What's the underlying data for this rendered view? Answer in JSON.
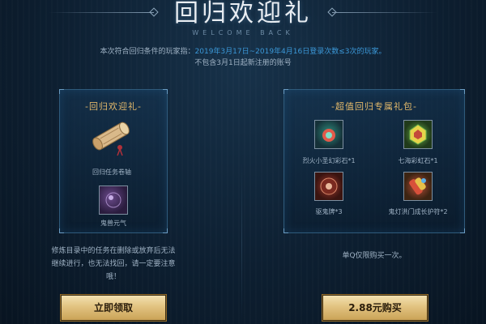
{
  "header": {
    "title": "回归欢迎礼",
    "subtitle": "WELCOME BACK",
    "desc_line1_prefix": "本次符合回归条件的玩家指：",
    "desc_line1_highlight": "2019年3月17日~2019年4月16日登录次数≤3次的玩家。",
    "desc_line2": "不包含3月1日起新注册的账号"
  },
  "left_panel": {
    "title": "-回归欢迎礼-",
    "items": [
      {
        "label": "回归任务卷轴",
        "icon": "scroll-icon"
      },
      {
        "label": "鬼兽元气",
        "icon": "spirit-orb-icon"
      }
    ],
    "note_line1": "修炼目录中的任务在删除或放弃后无法",
    "note_line2": "继续进行，也无法找回，请一定要注意哦！",
    "button_label": "立即领取"
  },
  "right_panel": {
    "title": "-超值回归专属礼包-",
    "items": [
      {
        "label": "烈火小圣幻彩石*1",
        "icon": "flame-gem-icon"
      },
      {
        "label": "七海彩虹石*1",
        "icon": "rainbow-stone-icon"
      },
      {
        "label": "驱鬼牌*3",
        "icon": "ghost-token-icon"
      },
      {
        "label": "鬼灯洪门成长护符*2",
        "icon": "growth-charm-icon"
      }
    ],
    "note": "单Q仅限购买一次。",
    "button_label": "2.88元购买"
  },
  "colors": {
    "accent_gold": "#e2b86a",
    "highlight_blue": "#3b98d8",
    "button_gold": "#e2c381"
  }
}
